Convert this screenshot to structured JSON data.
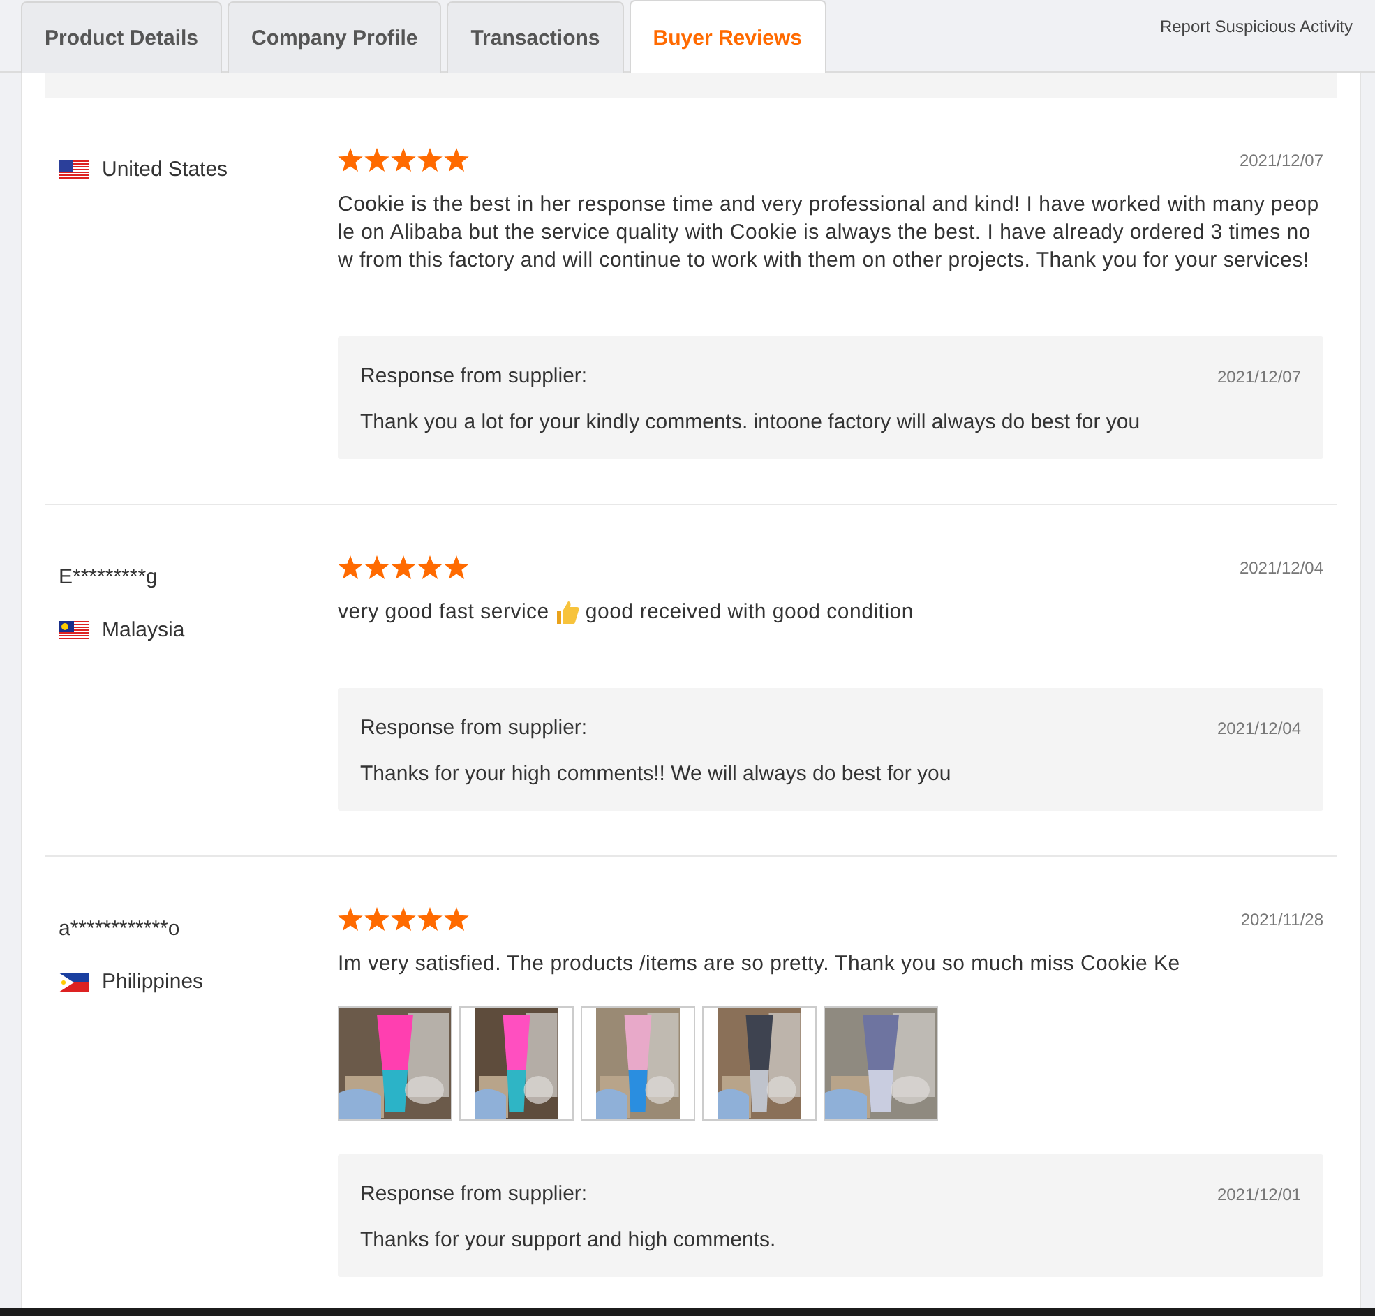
{
  "tabs": [
    {
      "label": "Product Details",
      "selected": false
    },
    {
      "label": "Company Profile",
      "selected": false
    },
    {
      "label": "Transactions",
      "selected": false
    },
    {
      "label": "Buyer Reviews",
      "selected": true
    }
  ],
  "report_link": "Report Suspicious Activity",
  "reviews": [
    {
      "country": "United States",
      "kind": "us",
      "stars": 5,
      "date": "2021/12/07",
      "text": [
        "Cookie is the best in her response time and very professional and kind! I have worked with many people on Alibaba but the service quality with Cookie is always the best. I have already ordered 3 times now from this factory and will continue to work with them on other projects. Thank you for your services!"
      ],
      "response": {
        "label": "Response from supplier:",
        "date": "2021/12/07",
        "text": "Thank you a lot for your kindly comments. intoone factory will always do best for you"
      }
    },
    {
      "user": "E*********g",
      "country": "Malaysia",
      "kind": "my",
      "stars": 5,
      "date": "2021/12/04",
      "text": [
        "very good fast service",
        "good received with good condition"
      ],
      "response": {
        "label": "Response from supplier:",
        "date": "2021/12/04",
        "text": "Thanks for your high comments!! We will always do best for you"
      }
    },
    {
      "user": "a************o",
      "country": "Philippines",
      "kind": "ph",
      "stars": 5,
      "date": "2021/11/28",
      "text": [
        "Im very satisfied. The products /items are so pretty. Thank you so much miss Cookie Ke"
      ],
      "photos": [
        {
          "kind": "picture"
        },
        {
          "kind": "picture"
        },
        {
          "kind": "picture"
        },
        {
          "kind": "picture"
        },
        {
          "kind": "picture"
        }
      ],
      "response": {
        "label": "Response from supplier:",
        "date": "2021/12/01",
        "text": "Thanks for your support and high comments."
      }
    }
  ]
}
